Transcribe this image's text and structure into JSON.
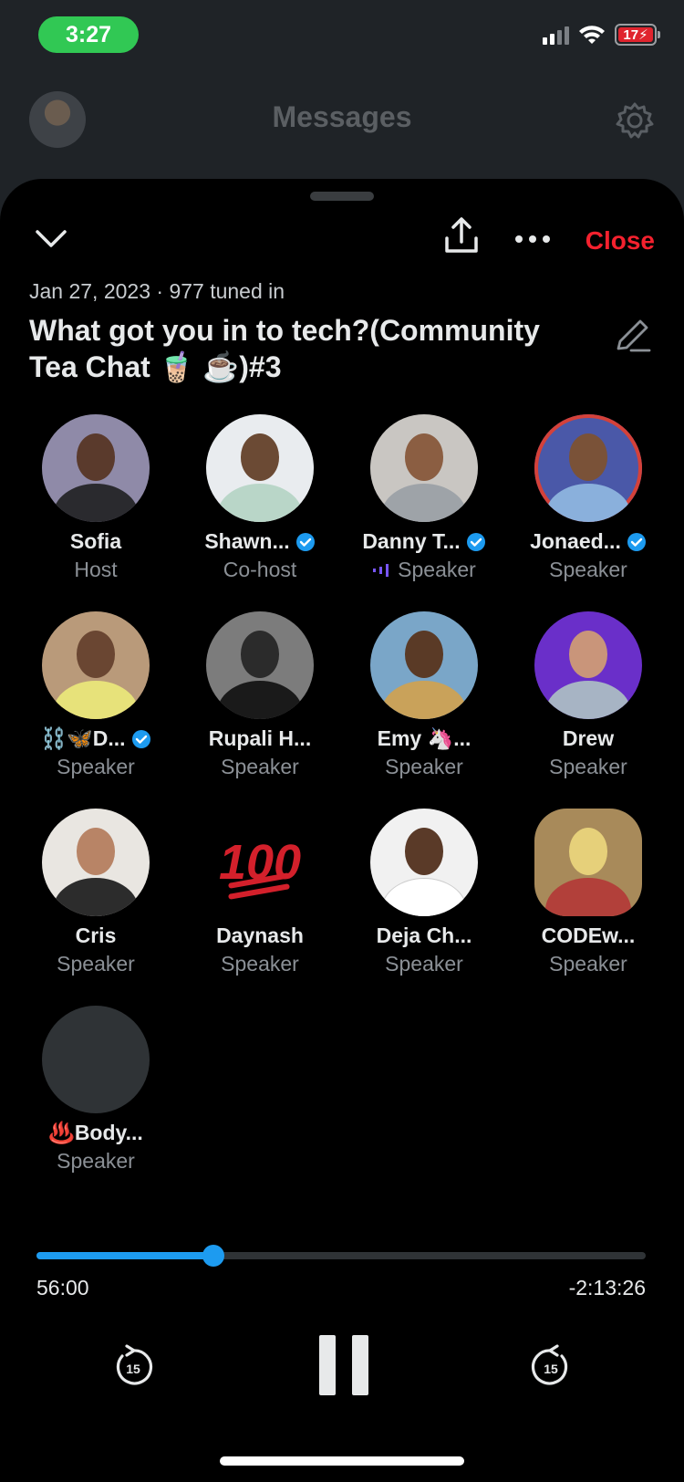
{
  "status_bar": {
    "time": "3:27",
    "battery": "17",
    "icons": [
      "signal-icon",
      "wifi-icon",
      "battery-charging-icon"
    ]
  },
  "background_app": {
    "title": "Messages",
    "icons": [
      "avatar",
      "gear-icon"
    ]
  },
  "space": {
    "meta": "Jan 27, 2023 · 977 tuned in",
    "title": "What got you in to tech?(Community Tea Chat 🧋 ☕️)#3",
    "close_label": "Close",
    "icons": [
      "chevron-down-icon",
      "share-icon",
      "more-icon",
      "edit-icon"
    ]
  },
  "speakers": [
    {
      "name": "Sofia",
      "role": "Host",
      "verified": false
    },
    {
      "name": "Shawn...",
      "role": "Co-host",
      "verified": true
    },
    {
      "name": "Danny T...",
      "role": "Speaker",
      "verified": true,
      "speaking": true
    },
    {
      "name": "Jonaed...",
      "role": "Speaker",
      "verified": true
    },
    {
      "name": "⛓️🦋D...",
      "role": "Speaker",
      "verified": true
    },
    {
      "name": "Rupali H...",
      "role": "Speaker",
      "verified": false
    },
    {
      "name": "Emy 🦄...",
      "role": "Speaker",
      "verified": false
    },
    {
      "name": "Drew",
      "role": "Speaker",
      "verified": false
    },
    {
      "name": "Cris",
      "role": "Speaker",
      "verified": false
    },
    {
      "name": "Daynash",
      "role": "Speaker",
      "verified": false
    },
    {
      "name": "Deja Ch...",
      "role": "Speaker",
      "verified": false
    },
    {
      "name": "CODEw...",
      "role": "Speaker",
      "verified": false
    },
    {
      "name": "♨️Body...",
      "role": "Speaker",
      "verified": false
    }
  ],
  "player": {
    "elapsed": "56:00",
    "remaining": "-2:13:26",
    "progress_fraction": 0.29,
    "skip_back_label": "15",
    "skip_forward_label": "15",
    "accent": "#1d9bf0"
  },
  "colors": {
    "accent": "#1d9bf0",
    "close": "#f4212e",
    "status_time_bg": "#31c854"
  }
}
